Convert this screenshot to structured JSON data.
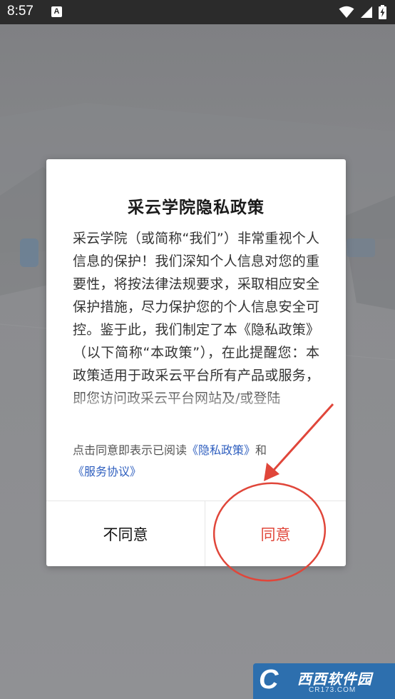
{
  "status_bar": {
    "time": "8:57",
    "notification_icon": "A",
    "icons": [
      "wifi-icon",
      "signal-icon",
      "battery-charging-icon"
    ]
  },
  "dialog": {
    "title": "采云学院隐私政策",
    "body": "采云学院（或简称“我们”）非常重视个人信息的保护！我们深知个人信息对您的重要性，将按法律法规要求，采取相应安全保护措施，尽力保护您的个人信息安全可控。鉴于此，我们制定了本《隐私政策》（以下简称“本政策”），在此提醒您：本政策适用于政采云平台所有产品或服务，即您访问政采云平台网站及/或登陆",
    "consent_prefix": "点击同意即表示已阅读",
    "privacy_link": "《隐私政策》",
    "consent_and": "和",
    "service_link": "《服务协议》",
    "disagree_label": "不同意",
    "agree_label": "同意"
  },
  "watermark": {
    "letter": "C",
    "brand": "西西软件园",
    "domain": "CR173.COM"
  },
  "colors": {
    "agree": "#e0463a",
    "link": "#2f5fbf",
    "annotation": "#e0463a",
    "watermark_bg": "#2d6fae"
  }
}
